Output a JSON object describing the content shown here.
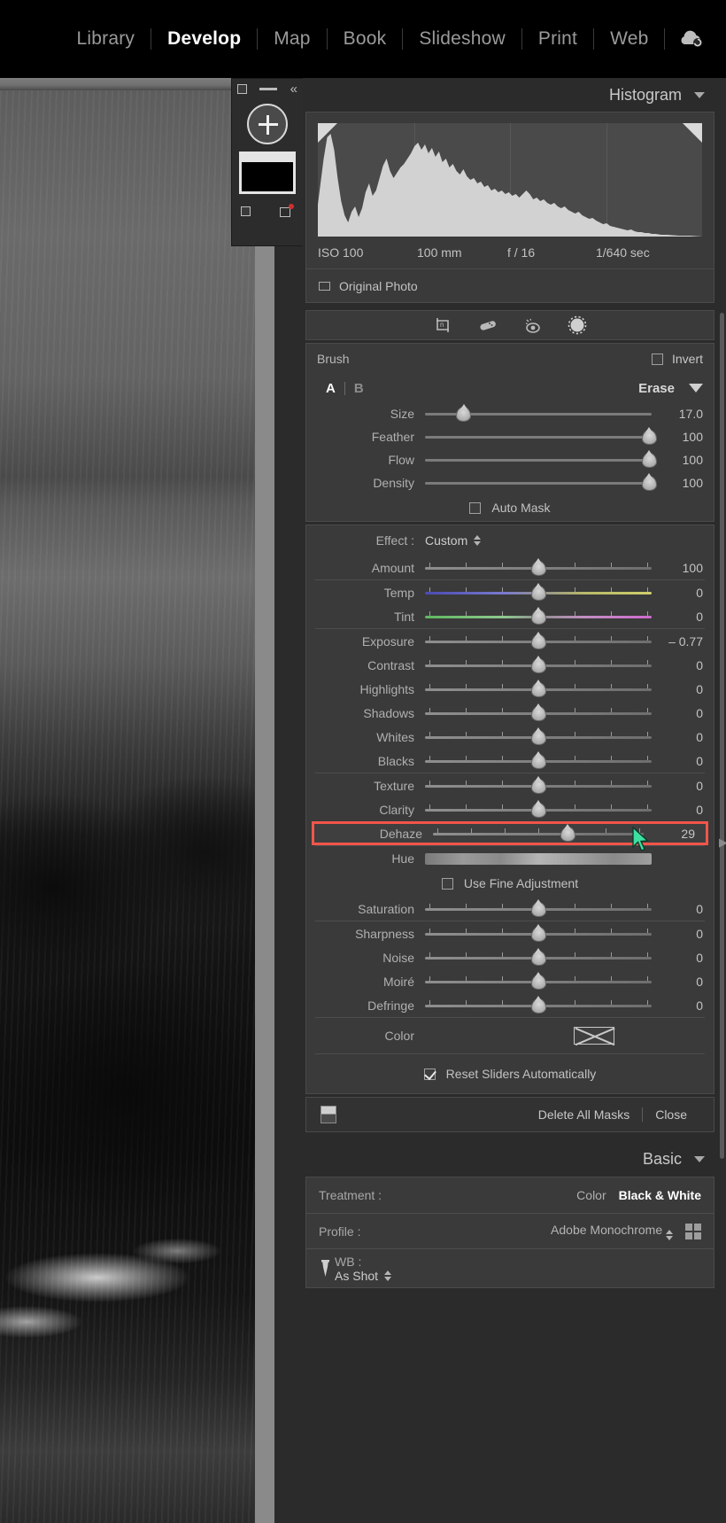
{
  "module_bar": {
    "items": [
      {
        "label": "Library",
        "active": false
      },
      {
        "label": "Develop",
        "active": true
      },
      {
        "label": "Map",
        "active": false
      },
      {
        "label": "Book",
        "active": false
      },
      {
        "label": "Slideshow",
        "active": false
      },
      {
        "label": "Print",
        "active": false
      },
      {
        "label": "Web",
        "active": false
      }
    ],
    "cloud_icon": "cloud-sync-icon"
  },
  "tool_palette": {
    "collapse_label": "«",
    "add_mask_label": "+",
    "icons": [
      "square-icon",
      "dash-icon",
      "chevron-left-icon",
      "add-new-mask-icon",
      "mask-thumbnail",
      "duplicate-mask-icon"
    ]
  },
  "histogram": {
    "title": "Histogram",
    "meta": {
      "iso": "ISO 100",
      "focal": "100 mm",
      "aperture": "f / 16",
      "shutter": "1/640 sec"
    },
    "original_photo_label": "Original Photo"
  },
  "tool_strip": {
    "tools": [
      "crop-overlay-icon",
      "healing-brush-icon",
      "red-eye-icon",
      "masking-icon"
    ]
  },
  "brush": {
    "title": "Brush",
    "invert_label": "Invert",
    "invert_checked": false,
    "a_label": "A",
    "b_label": "B",
    "erase_label": "Erase",
    "active_brush": "A",
    "sliders": [
      {
        "name": "Size",
        "value": "17.0",
        "pct": 17
      },
      {
        "name": "Feather",
        "value": "100",
        "pct": 99
      },
      {
        "name": "Flow",
        "value": "100",
        "pct": 99
      },
      {
        "name": "Density",
        "value": "100",
        "pct": 99
      }
    ],
    "auto_mask_label": "Auto Mask",
    "auto_mask_checked": false
  },
  "effect": {
    "label": "Effect :",
    "value": "Custom",
    "amount": {
      "name": "Amount",
      "value": "100",
      "pct": 50
    },
    "white_balance": [
      {
        "name": "Temp",
        "value": "0",
        "pct": 50,
        "bar": "temp"
      },
      {
        "name": "Tint",
        "value": "0",
        "pct": 50,
        "bar": "tint"
      }
    ],
    "tone": [
      {
        "name": "Exposure",
        "value": "– 0.77",
        "pct": 50
      },
      {
        "name": "Contrast",
        "value": "0",
        "pct": 50
      },
      {
        "name": "Highlights",
        "value": "0",
        "pct": 50
      },
      {
        "name": "Shadows",
        "value": "0",
        "pct": 50
      },
      {
        "name": "Whites",
        "value": "0",
        "pct": 50
      },
      {
        "name": "Blacks",
        "value": "0",
        "pct": 50
      }
    ],
    "presence": [
      {
        "name": "Texture",
        "value": "0",
        "pct": 50
      },
      {
        "name": "Clarity",
        "value": "0",
        "pct": 50
      }
    ],
    "dehaze": {
      "name": "Dehaze",
      "value": "29",
      "pct": 64,
      "highlight_color": "#f2554a",
      "cursor": "arrow-cursor"
    },
    "hue": {
      "name": "Hue",
      "fine_adjust_label": "Use Fine Adjustment",
      "fine_adjust_checked": false
    },
    "saturation": {
      "name": "Saturation",
      "value": "0",
      "pct": 50
    },
    "detail": [
      {
        "name": "Sharpness",
        "value": "0",
        "pct": 50
      },
      {
        "name": "Noise",
        "value": "0",
        "pct": 50
      },
      {
        "name": "Moiré",
        "value": "0",
        "pct": 50
      },
      {
        "name": "Defringe",
        "value": "0",
        "pct": 50
      }
    ],
    "color": {
      "name": "Color",
      "swatch": "no-color-swatch"
    },
    "reset_sliders_label": "Reset Sliders Automatically",
    "reset_sliders_checked": true
  },
  "mask_footer": {
    "switch": "mask-toggle-switch",
    "delete_all_label": "Delete All Masks",
    "close_label": "Close"
  },
  "basic": {
    "title": "Basic",
    "treatment": {
      "label": "Treatment :",
      "options": [
        "Color",
        "Black & White"
      ],
      "selected": "Black & White"
    },
    "profile": {
      "label": "Profile :",
      "value": "Adobe Monochrome",
      "browse_icon": "profile-browser-icon"
    },
    "wb": {
      "label": "WB :",
      "value": "As Shot",
      "eyedropper": "white-balance-selector-icon"
    }
  },
  "colors": {
    "panel_bg": "#2b2b2b",
    "card_bg": "#3a3a3a",
    "highlight": "#f2554a",
    "cursor": "#3de0a0",
    "accent_text": "#ffffff"
  }
}
